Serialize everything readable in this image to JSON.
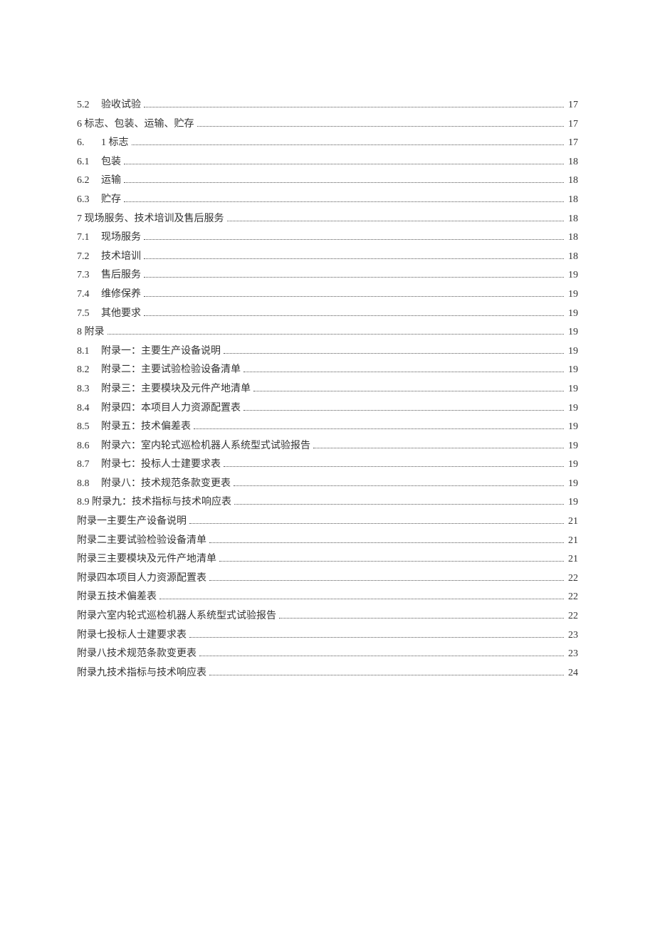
{
  "toc": [
    {
      "num": "5.2",
      "title": "验收试验",
      "page": "17",
      "indent": true
    },
    {
      "num": "",
      "title": "6 标志、包装、运输、贮存",
      "page": "17",
      "indent": false
    },
    {
      "num": "6.",
      "title": "1 标志",
      "page": "17",
      "indent": true
    },
    {
      "num": "6.1",
      "title": "包装",
      "page": "18",
      "indent": true
    },
    {
      "num": "6.2",
      "title": "运输",
      "page": "18",
      "indent": true
    },
    {
      "num": "6.3",
      "title": "贮存",
      "page": "18",
      "indent": true
    },
    {
      "num": "",
      "title": "7 现场服务、技术培训及售后服务",
      "page": "18",
      "indent": false
    },
    {
      "num": "7.1",
      "title": "现场服务",
      "page": "18",
      "indent": true
    },
    {
      "num": "7.2",
      "title": "技术培训",
      "page": "18",
      "indent": true
    },
    {
      "num": "7.3",
      "title": "售后服务",
      "page": "19",
      "indent": true
    },
    {
      "num": "7.4",
      "title": "维修保养",
      "page": "19",
      "indent": true
    },
    {
      "num": "7.5",
      "title": "其他要求",
      "page": "19",
      "indent": true
    },
    {
      "num": "",
      "title": "8 附录",
      "page": "19",
      "indent": false
    },
    {
      "num": "8.1",
      "title": "附录一：主要生产设备说明",
      "page": "19",
      "indent": true
    },
    {
      "num": "8.2",
      "title": "附录二：主要试验检验设备清单",
      "page": "19",
      "indent": true
    },
    {
      "num": "8.3",
      "title": "附录三：主要模块及元件产地清单",
      "page": "19",
      "indent": true
    },
    {
      "num": "8.4",
      "title": "附录四：本项目人力资源配置表",
      "page": "19",
      "indent": true
    },
    {
      "num": "8.5",
      "title": "附录五：技术偏差表",
      "page": "19",
      "indent": true
    },
    {
      "num": "8.6",
      "title": "附录六：室内轮式巡检机器人系统型式试验报告",
      "page": "19",
      "indent": true
    },
    {
      "num": "8.7",
      "title": "附录七：投标人士建要求表",
      "page": "19",
      "indent": true
    },
    {
      "num": "8.8",
      "title": "附录八：技术规范条款变更表",
      "page": "19",
      "indent": true
    },
    {
      "num": "",
      "title": "8.9 附录九：技术指标与技术响应表",
      "page": "19",
      "indent": false
    },
    {
      "num": "",
      "title": "附录一主要生产设备说明",
      "page": "21",
      "indent": false
    },
    {
      "num": "",
      "title": "附录二主要试验检验设备清单",
      "page": "21",
      "indent": false
    },
    {
      "num": "",
      "title": "附录三主要模块及元件产地清单",
      "page": "21",
      "indent": false
    },
    {
      "num": "",
      "title": "附录四本项目人力资源配置表",
      "page": "22",
      "indent": false
    },
    {
      "num": "",
      "title": "附录五技术偏差表",
      "page": "22",
      "indent": false
    },
    {
      "num": "",
      "title": "附录六室内轮式巡检机器人系统型式试验报告",
      "page": "22",
      "indent": false
    },
    {
      "num": "",
      "title": "附录七投标人士建要求表",
      "page": "23",
      "indent": false
    },
    {
      "num": "",
      "title": "附录八技术规范条款变更表",
      "page": "23",
      "indent": false
    },
    {
      "num": "",
      "title": "附录九技术指标与技术响应表",
      "page": "24",
      "indent": false
    }
  ]
}
